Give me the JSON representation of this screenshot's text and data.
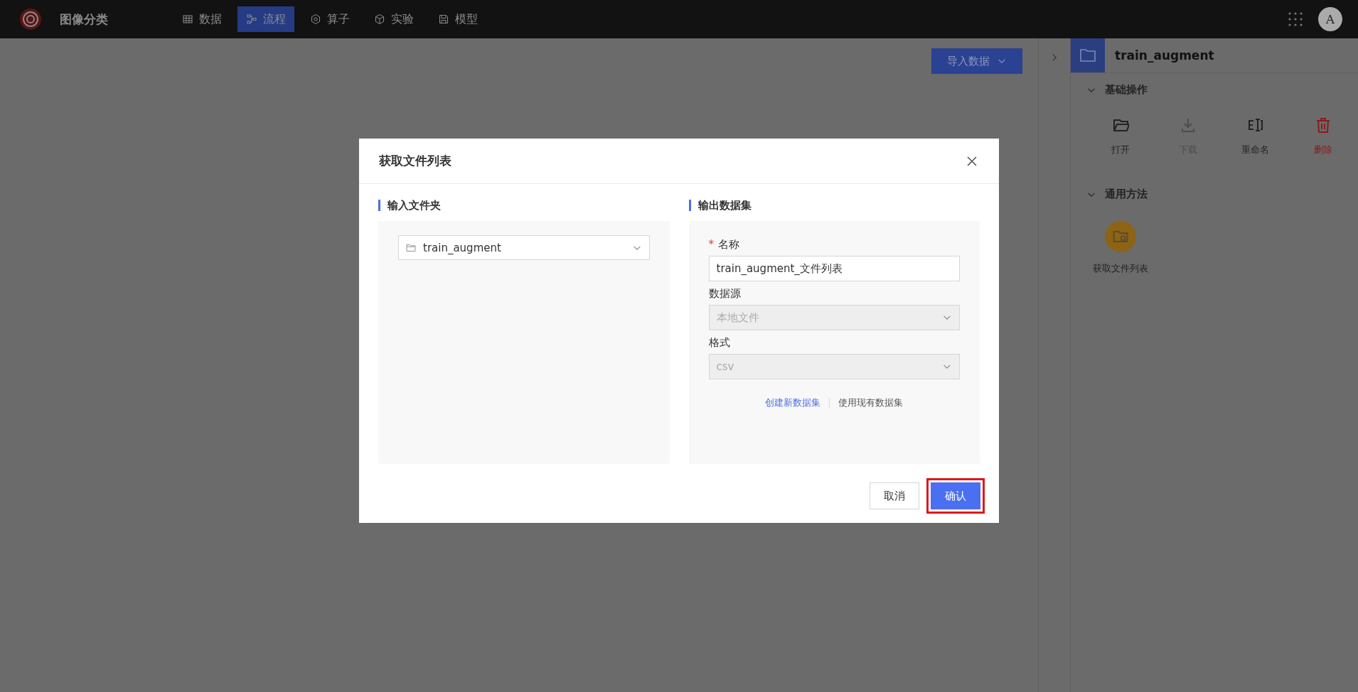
{
  "app": {
    "title": "图像分类"
  },
  "nav": [
    {
      "label": "数据",
      "selected": false
    },
    {
      "label": "流程",
      "selected": true
    },
    {
      "label": "算子",
      "selected": false
    },
    {
      "label": "实验",
      "selected": false
    },
    {
      "label": "模型",
      "selected": false
    }
  ],
  "user": {
    "initial": "A"
  },
  "canvas": {
    "import_button": "导入数据"
  },
  "side_panel": {
    "title": "train_augment",
    "sections": [
      {
        "title": "基础操作",
        "expanded": true,
        "actions": [
          {
            "label": "打开",
            "kind": "default",
            "disabled": false
          },
          {
            "label": "下载",
            "kind": "default",
            "disabled": true
          },
          {
            "label": "重命名",
            "kind": "default",
            "disabled": false
          },
          {
            "label": "删除",
            "kind": "danger",
            "disabled": false
          }
        ]
      },
      {
        "title": "通用方法",
        "expanded": true,
        "actions": [
          {
            "label": "获取文件列表",
            "kind": "round",
            "disabled": false
          }
        ]
      }
    ]
  },
  "dialog": {
    "title": "获取文件列表",
    "input": {
      "heading": "输入文件夹",
      "folder": "train_augment"
    },
    "output": {
      "heading": "输出数据集",
      "fields": [
        {
          "label": "名称",
          "required_mark": "*",
          "value": "train_augment_文件列表",
          "kind": "text",
          "disabled": false
        },
        {
          "label": "数据源",
          "value": "本地文件",
          "kind": "select",
          "disabled": true
        },
        {
          "label": "格式",
          "value": "csv",
          "kind": "select",
          "disabled": true
        }
      ],
      "modes": [
        {
          "label": "创建新数据集",
          "selected": true
        },
        {
          "label": "使用现有数据集",
          "selected": false
        }
      ]
    },
    "buttons": [
      {
        "label": "取消",
        "kind": "default",
        "highlighted": false
      },
      {
        "label": "确认",
        "kind": "primary",
        "highlighted": true
      }
    ]
  }
}
